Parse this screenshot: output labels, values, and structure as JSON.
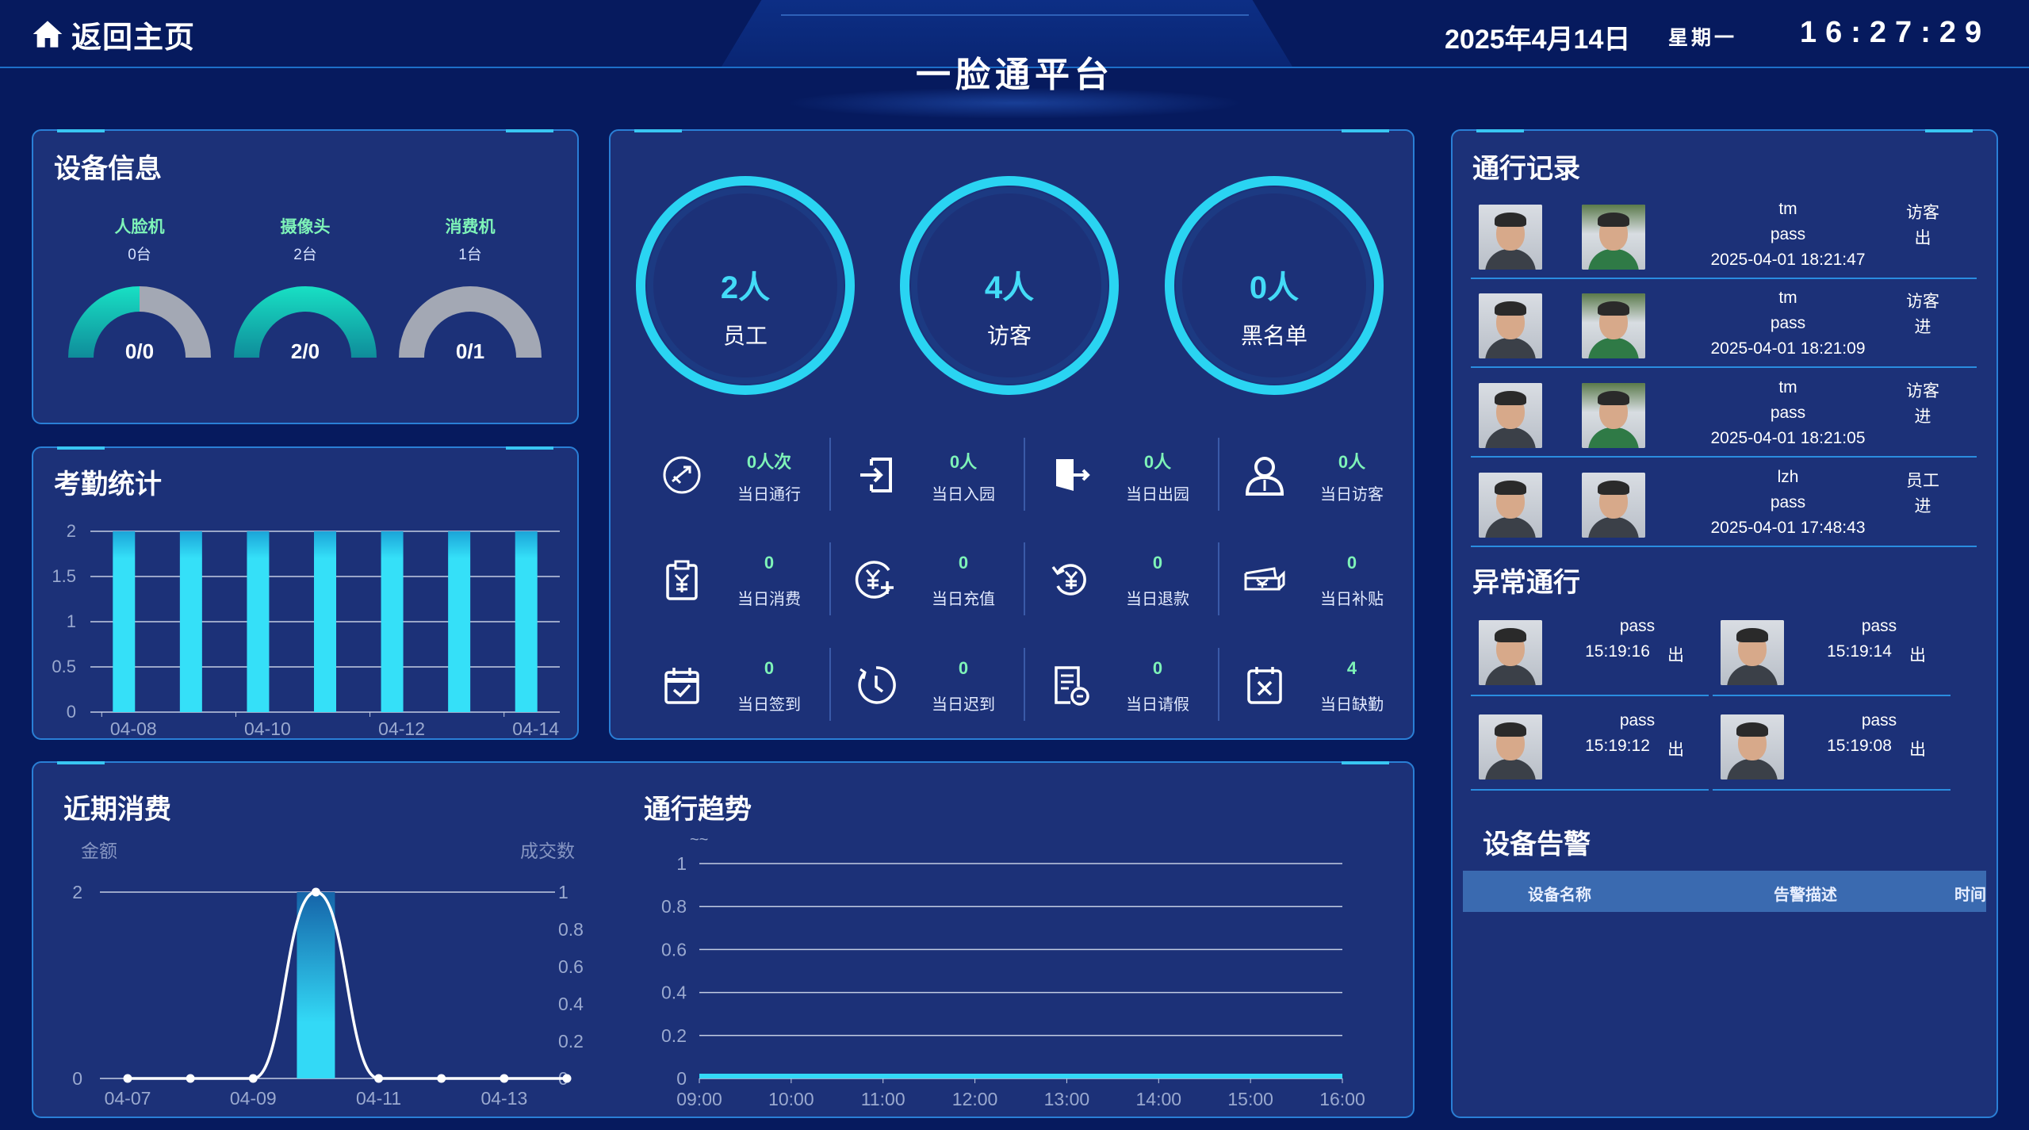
{
  "header": {
    "home_label": "返回主页",
    "title": "一脸通平台",
    "date": "2025年4月14日",
    "weekday": "星期一",
    "time": "16:27:29"
  },
  "device_info": {
    "title": "设备信息",
    "devices": [
      {
        "name": "人脸机",
        "count": "0台",
        "value": "0/0",
        "online": 0,
        "total": 0
      },
      {
        "name": "摄像头",
        "count": "2台",
        "value": "2/0",
        "online": 2,
        "total": 2
      },
      {
        "name": "消费机",
        "count": "1台",
        "value": "0/1",
        "online": 0,
        "total": 1
      }
    ],
    "colors": {
      "online": "#18e0c4",
      "offline": "#a3a8b4"
    }
  },
  "attendance": {
    "title": "考勤统计",
    "chart_data": {
      "type": "bar",
      "categories": [
        "04-08",
        "04-09",
        "04-10",
        "04-11",
        "04-12",
        "04-13",
        "04-14"
      ],
      "x_tick_labels": [
        "04-08",
        "04-10",
        "04-12",
        "04-14"
      ],
      "values": [
        2,
        2,
        2,
        2,
        2,
        2,
        2
      ],
      "ylim": [
        0,
        2
      ],
      "y_ticks": [
        "0",
        "0.5",
        "1",
        "1.5",
        "2"
      ],
      "grid": true
    }
  },
  "overview": {
    "circles": [
      {
        "value": "2人",
        "label": "员工"
      },
      {
        "value": "4人",
        "label": "访客"
      },
      {
        "value": "0人",
        "label": "黑名单"
      }
    ],
    "stats": [
      {
        "icon": "pass-icon",
        "value": "0人次",
        "label": "当日通行"
      },
      {
        "icon": "enter-icon",
        "value": "0人",
        "label": "当日入园"
      },
      {
        "icon": "exit-icon",
        "value": "0人",
        "label": "当日出园"
      },
      {
        "icon": "visitor-icon",
        "value": "0人",
        "label": "当日访客"
      },
      {
        "icon": "consume-icon",
        "value": "0",
        "label": "当日消费"
      },
      {
        "icon": "recharge-icon",
        "value": "0",
        "label": "当日充值"
      },
      {
        "icon": "refund-icon",
        "value": "0",
        "label": "当日退款"
      },
      {
        "icon": "subsidy-icon",
        "value": "0",
        "label": "当日补贴"
      },
      {
        "icon": "checkin-icon",
        "value": "0",
        "label": "当日签到"
      },
      {
        "icon": "late-icon",
        "value": "0",
        "label": "当日迟到"
      },
      {
        "icon": "leave-icon",
        "value": "0",
        "label": "当日请假"
      },
      {
        "icon": "absent-icon",
        "value": "4",
        "label": "当日缺勤"
      }
    ]
  },
  "consumption": {
    "title": "近期消费",
    "chart_data": {
      "type": "line",
      "y_left_label": "金额",
      "y_right_label": "成交数",
      "categories": [
        "04-07",
        "04-08",
        "04-09",
        "04-10",
        "04-11",
        "04-12",
        "04-13",
        "04-14"
      ],
      "x_tick_labels": [
        "04-07",
        "04-09",
        "04-11",
        "04-13"
      ],
      "series": [
        {
          "values": [
            0,
            0,
            0,
            2,
            0,
            0,
            0,
            0
          ]
        },
        {
          "type": "bar",
          "values": [
            0,
            0,
            0,
            1,
            0,
            0,
            0,
            0
          ]
        }
      ],
      "ylim_left": [
        0,
        2
      ],
      "ylim_right": [
        0,
        1
      ],
      "y_left_ticks": [
        "0",
        "2"
      ],
      "y_right_ticks": [
        "0",
        "0.2",
        "0.4",
        "0.6",
        "0.8",
        "1"
      ]
    }
  },
  "traffic_trend": {
    "title": "通行趋势",
    "legend": "~~",
    "chart_data": {
      "type": "area",
      "x": [
        "09:00",
        "10:00",
        "11:00",
        "12:00",
        "13:00",
        "14:00",
        "15:00",
        "16:00"
      ],
      "values": [
        0,
        0,
        0,
        0,
        0,
        0,
        0,
        0
      ],
      "ylim": [
        0,
        1
      ],
      "y_ticks": [
        "0",
        "0.2",
        "0.4",
        "0.6",
        "0.8",
        "1"
      ],
      "grid": true
    }
  },
  "records": {
    "title": "通行记录",
    "items": [
      {
        "name": "tm",
        "status": "pass",
        "time": "2025-04-01 18:21:47",
        "type": "访客",
        "dir": "出"
      },
      {
        "name": "tm",
        "status": "pass",
        "time": "2025-04-01 18:21:09",
        "type": "访客",
        "dir": "进"
      },
      {
        "name": "tm",
        "status": "pass",
        "time": "2025-04-01 18:21:05",
        "type": "访客",
        "dir": "进"
      },
      {
        "name": "lzh",
        "status": "pass",
        "time": "2025-04-01 17:48:43",
        "type": "员工",
        "dir": "进"
      }
    ]
  },
  "abnormal": {
    "title": "异常通行",
    "items": [
      {
        "status": "pass",
        "time": "15:19:16",
        "dir": "出"
      },
      {
        "status": "pass",
        "time": "15:19:14",
        "dir": "出"
      },
      {
        "status": "pass",
        "time": "15:19:12",
        "dir": "出"
      },
      {
        "status": "pass",
        "time": "15:19:08",
        "dir": "出"
      }
    ]
  },
  "alarm": {
    "title": "设备告警",
    "columns": [
      "设备名称",
      "告警描述",
      "时间"
    ]
  }
}
